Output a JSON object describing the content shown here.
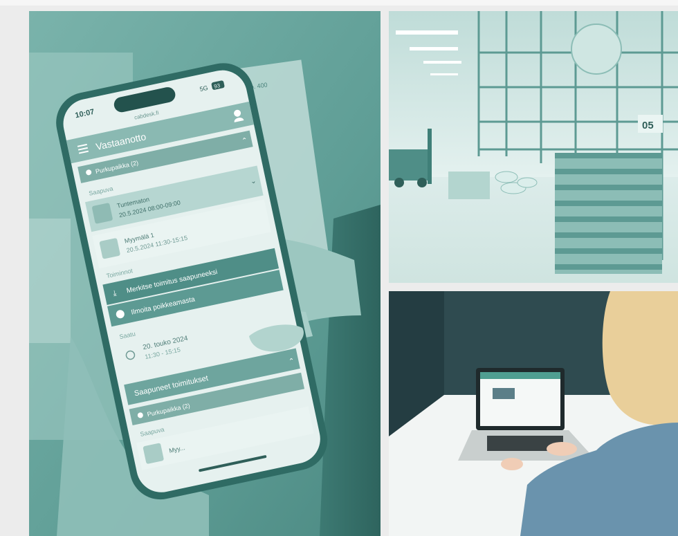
{
  "phone_app": {
    "status_time": "10:07",
    "status_center": "cabdesk.fi",
    "status_network": "5G",
    "status_battery": "93",
    "header_title": "Vastaanotto",
    "location_1": "Purkupaikka (2)",
    "section_incoming": "Saapuva",
    "delivery_1_title": "Tuntematon",
    "delivery_1_time": "20.5.2024 08:00-09:00",
    "delivery_2_title": "Myymälä 1",
    "delivery_2_time": "20.5.2024 11:30-15:15",
    "section_actions": "Toiminnot",
    "action_mark_arrived": "Merkitse toimitus saapuneeksi",
    "action_report_deviation": "Ilmoita poikkeamasta",
    "section_time": "Saatu",
    "time_date": "20. touko 2024",
    "time_range": "11:30 - 15:15",
    "section_arrived": "Saapuneet toimitukset",
    "location_2": "Purkupaikka (2)",
    "section_incoming_2": "Saapuva",
    "delivery_3_title": "Myy...",
    "doc_top_right": "Pensel No. 400"
  },
  "warehouse": {
    "aisle_sign": "05"
  },
  "colors": {
    "teal_dark": "#3f7f78",
    "teal_mid": "#6fa9a1",
    "teal_light": "#cfe5e1",
    "wall_dark": "#2f4b50"
  }
}
